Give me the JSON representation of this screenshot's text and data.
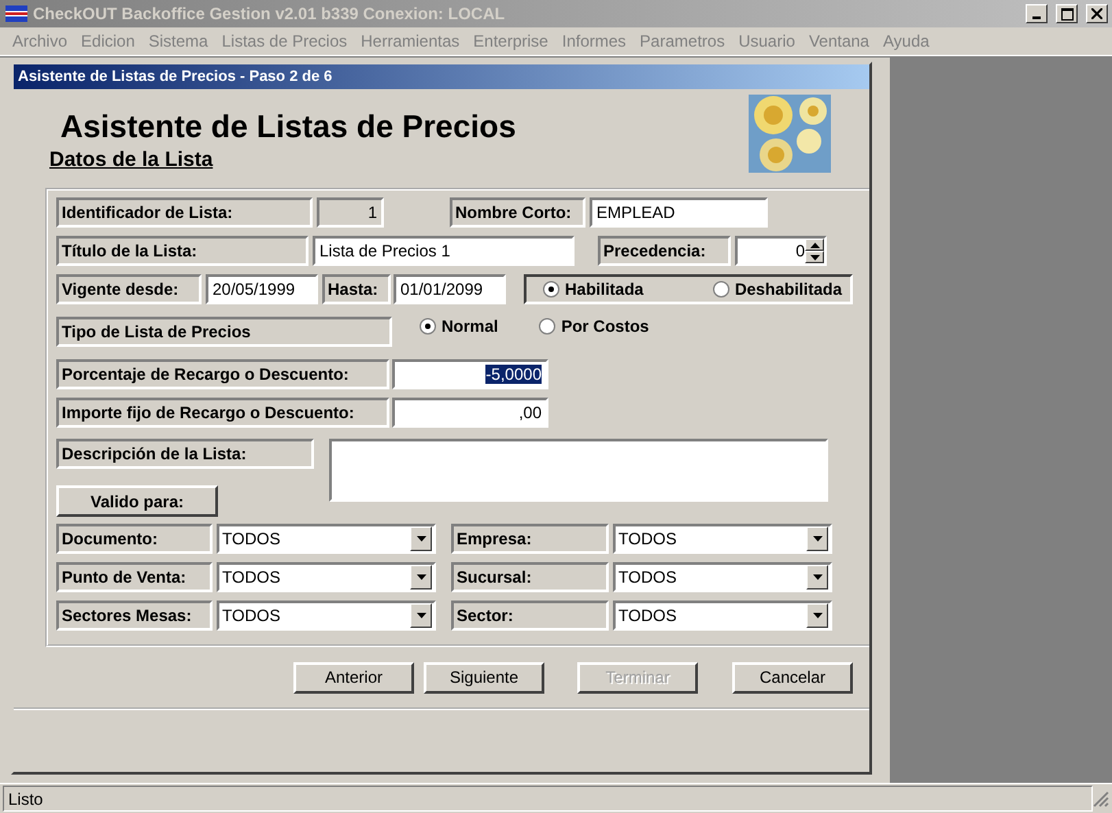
{
  "window": {
    "title": "CheckOUT Backoffice Gestion v2.01 b339 Conexion: LOCAL"
  },
  "menu": [
    "Archivo",
    "Edicion",
    "Sistema",
    "Listas de Precios",
    "Herramientas",
    "Enterprise",
    "Informes",
    "Parametros",
    "Usuario",
    "Ventana",
    "Ayuda"
  ],
  "dialog": {
    "title": "Asistente de Listas de Precios - Paso 2 de 6",
    "heading": "Asistente de Listas de Precios",
    "subheading": "Datos de la Lista",
    "identificador": {
      "label": "Identificador de Lista:",
      "value": "1",
      "disabled": true
    },
    "nombre_corto": {
      "label": "Nombre Corto:",
      "value": "EMPLEAD"
    },
    "titulo": {
      "label": "Título de la Lista:",
      "value": "Lista de Precios 1"
    },
    "precedencia": {
      "label": "Precedencia:",
      "value": "0"
    },
    "vigente_desde": {
      "label": "Vigente desde:",
      "value": "20/05/1999"
    },
    "hasta": {
      "label": "Hasta:",
      "value": "01/01/2099"
    },
    "estado": [
      {
        "label": "Habilitada",
        "selected": true
      },
      {
        "label": "Deshabilitada",
        "selected": false
      }
    ],
    "tipo": {
      "label": "Tipo de Lista de Precios",
      "options": [
        {
          "label": "Normal",
          "selected": true
        },
        {
          "label": "Por Costos",
          "selected": false
        }
      ]
    },
    "porcentaje": {
      "label": "Porcentaje de Recargo o Descuento:",
      "value": "-5,0000",
      "highlighted": true
    },
    "importe": {
      "label": "Importe fijo de Recargo o Descuento:",
      "value": ",00",
      "highlighted": false
    },
    "descripcion": {
      "label": "Descripción de la Lista:"
    },
    "valido_para": "Valido para:",
    "filters": [
      {
        "label": "Documento:",
        "value": "TODOS"
      },
      {
        "label": "Empresa:",
        "value": "TODOS"
      },
      {
        "label": "Punto de Venta:",
        "value": "TODOS"
      },
      {
        "label": "Sucursal:",
        "value": "TODOS"
      },
      {
        "label": "Sectores Mesas:",
        "value": "TODOS"
      },
      {
        "label": "Sector:",
        "value": "TODOS"
      }
    ],
    "buttons": [
      {
        "label": "Anterior",
        "disabled": false
      },
      {
        "label": "Siguiente",
        "disabled": false
      },
      {
        "label": "Terminar",
        "disabled": true
      },
      {
        "label": "Cancelar",
        "disabled": false
      }
    ]
  },
  "status_bar": "Listo"
}
